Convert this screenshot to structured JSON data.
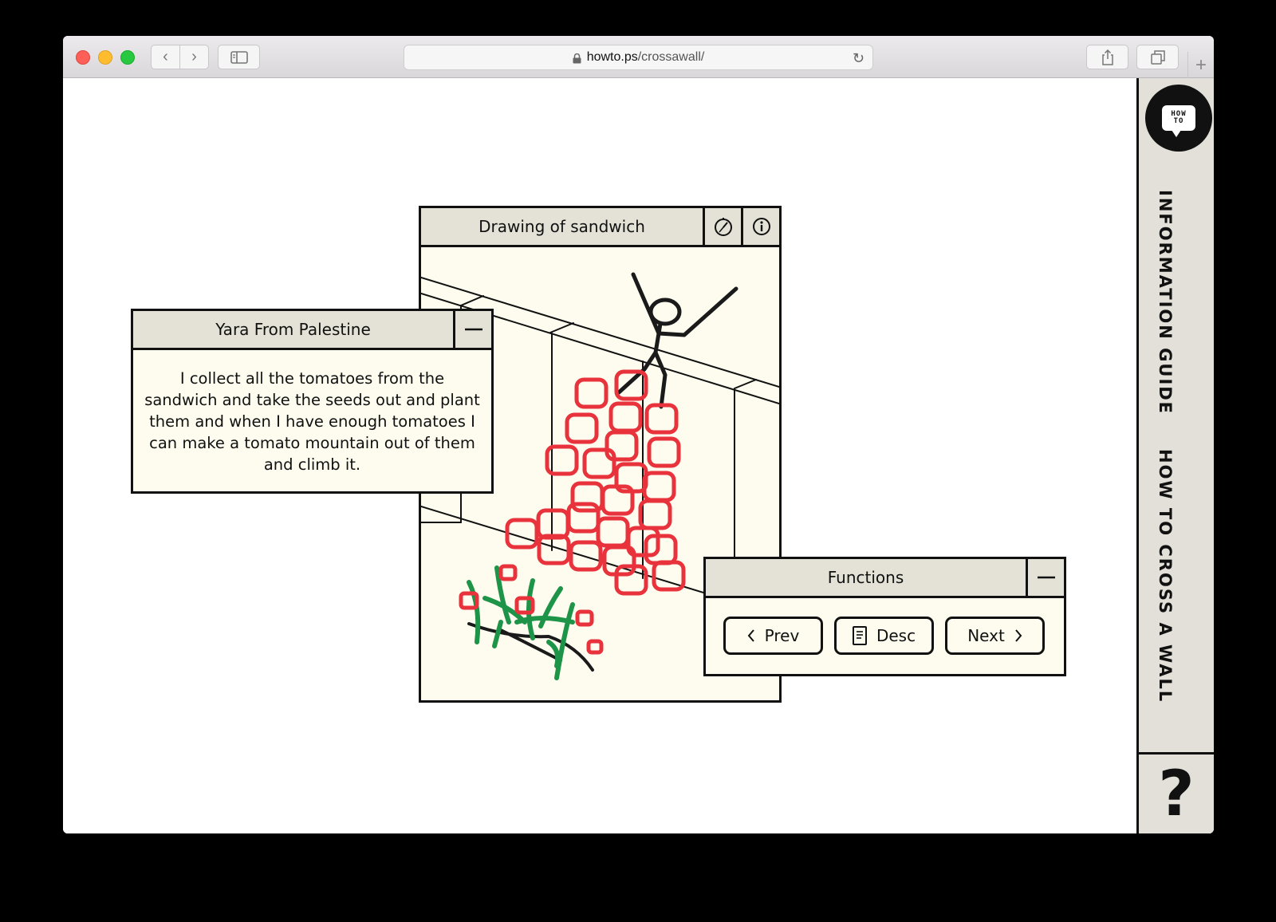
{
  "browser": {
    "url_host": "howto.ps",
    "url_path": "/crossawall/"
  },
  "sidebar": {
    "logo_text_line1": "HOW",
    "logo_text_line2": "TO",
    "section_info": "INFORMATION GUIDE",
    "section_cross": "HOW TO CROSS A WALL",
    "help_label": "?"
  },
  "drawing_panel": {
    "title": "Drawing of sandwich",
    "tool_icons": [
      "stopwatch-icon",
      "info-icon"
    ]
  },
  "story_panel": {
    "title": "Yara From Palestine",
    "text": "I collect all the tomatoes from the sandwich and take the seeds out and plant them and when I have enough tomatoes I can make a tomato mountain out of them and climb it."
  },
  "functions_panel": {
    "title": "Functions",
    "prev_label": "Prev",
    "desc_label": "Desc",
    "next_label": "Next"
  },
  "colors": {
    "panel_bg": "#fdfcee",
    "panel_header": "#e4e2d6",
    "sidebar_bg": "#e2e0d8",
    "tomato_red": "#e8323c",
    "plant_green": "#1e9448"
  }
}
